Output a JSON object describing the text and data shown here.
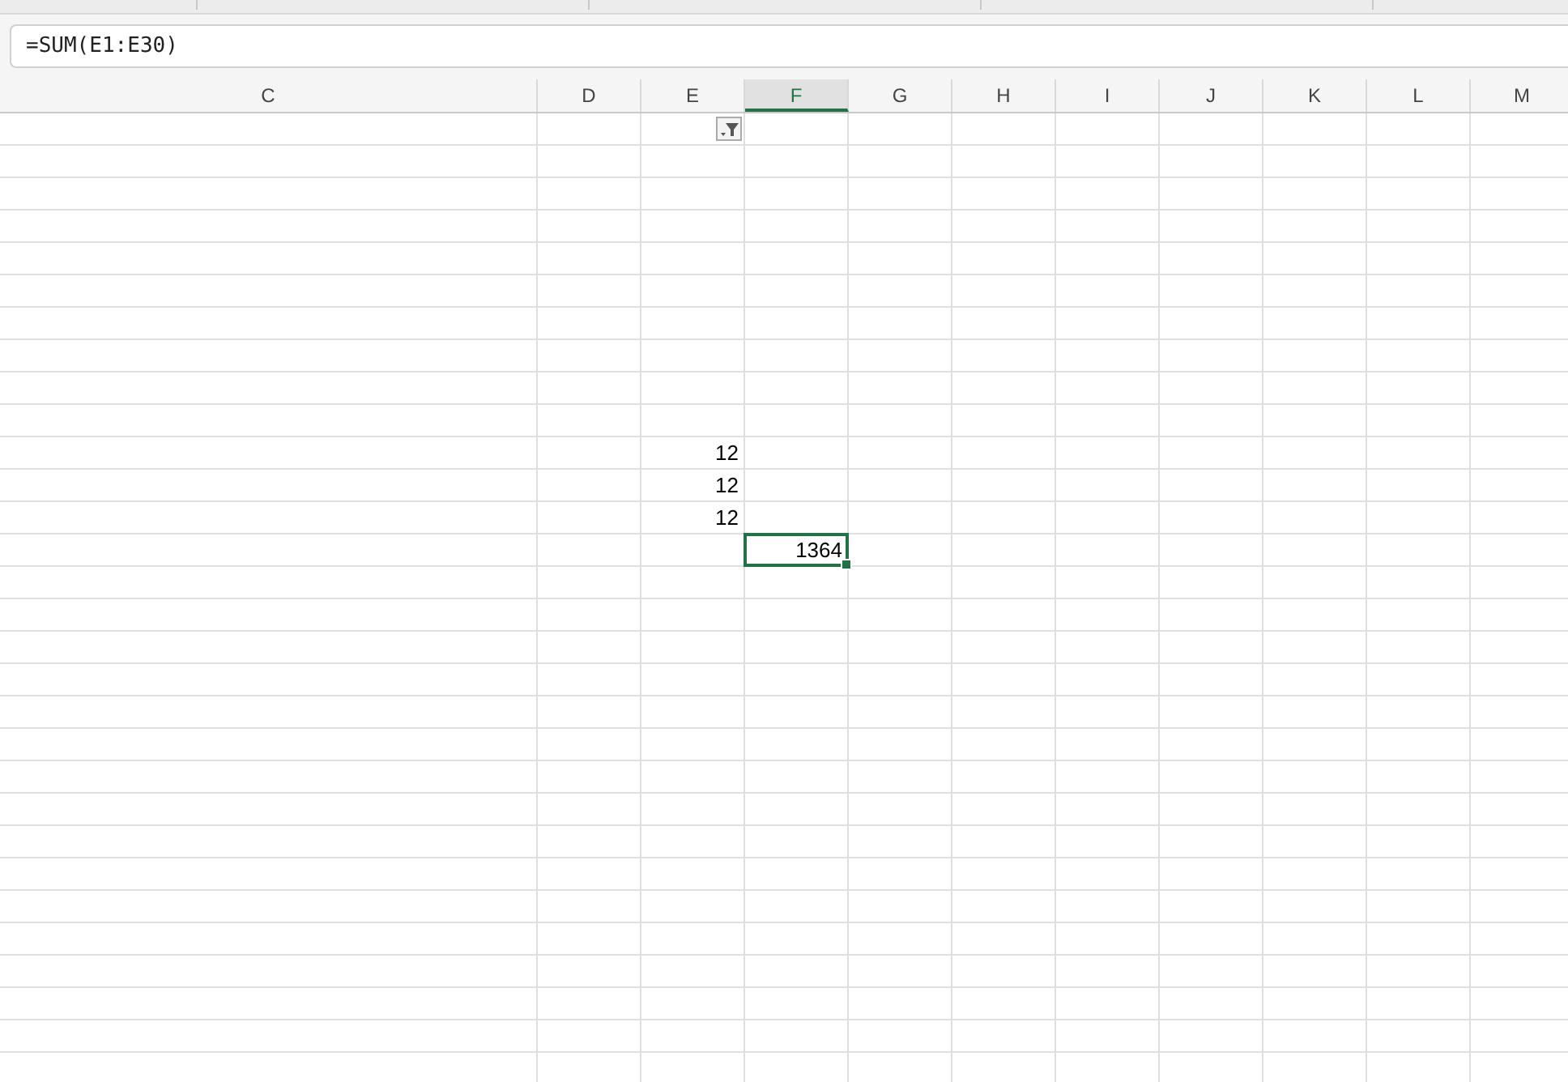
{
  "formula_bar": {
    "value": "=SUM(E1:E30)"
  },
  "columns": [
    {
      "label": "C",
      "selected": false,
      "filter_button": false
    },
    {
      "label": "D",
      "selected": false,
      "filter_button": false
    },
    {
      "label": "E",
      "selected": false,
      "filter_button": true
    },
    {
      "label": "F",
      "selected": true,
      "filter_button": false
    },
    {
      "label": "G",
      "selected": false,
      "filter_button": false
    },
    {
      "label": "H",
      "selected": false,
      "filter_button": false
    },
    {
      "label": "I",
      "selected": false,
      "filter_button": false
    },
    {
      "label": "J",
      "selected": false,
      "filter_button": false
    },
    {
      "label": "K",
      "selected": false,
      "filter_button": false
    },
    {
      "label": "L",
      "selected": false,
      "filter_button": false
    },
    {
      "label": "M",
      "selected": false,
      "filter_button": false
    }
  ],
  "rows": [
    {},
    {},
    {},
    {},
    {},
    {},
    {},
    {},
    {},
    {},
    {
      "cells": [
        null,
        null,
        {
          "value": "12",
          "selected": false
        }
      ]
    },
    {
      "cells": [
        null,
        null,
        {
          "value": "12",
          "selected": false
        }
      ]
    },
    {
      "cells": [
        null,
        null,
        {
          "value": "12",
          "selected": false
        }
      ]
    },
    {
      "cells": [
        null,
        null,
        null,
        {
          "value": "1364",
          "selected": true
        }
      ]
    },
    {},
    {},
    {},
    {},
    {},
    {},
    {},
    {},
    {},
    {},
    {},
    {},
    {},
    {},
    {},
    {}
  ]
}
